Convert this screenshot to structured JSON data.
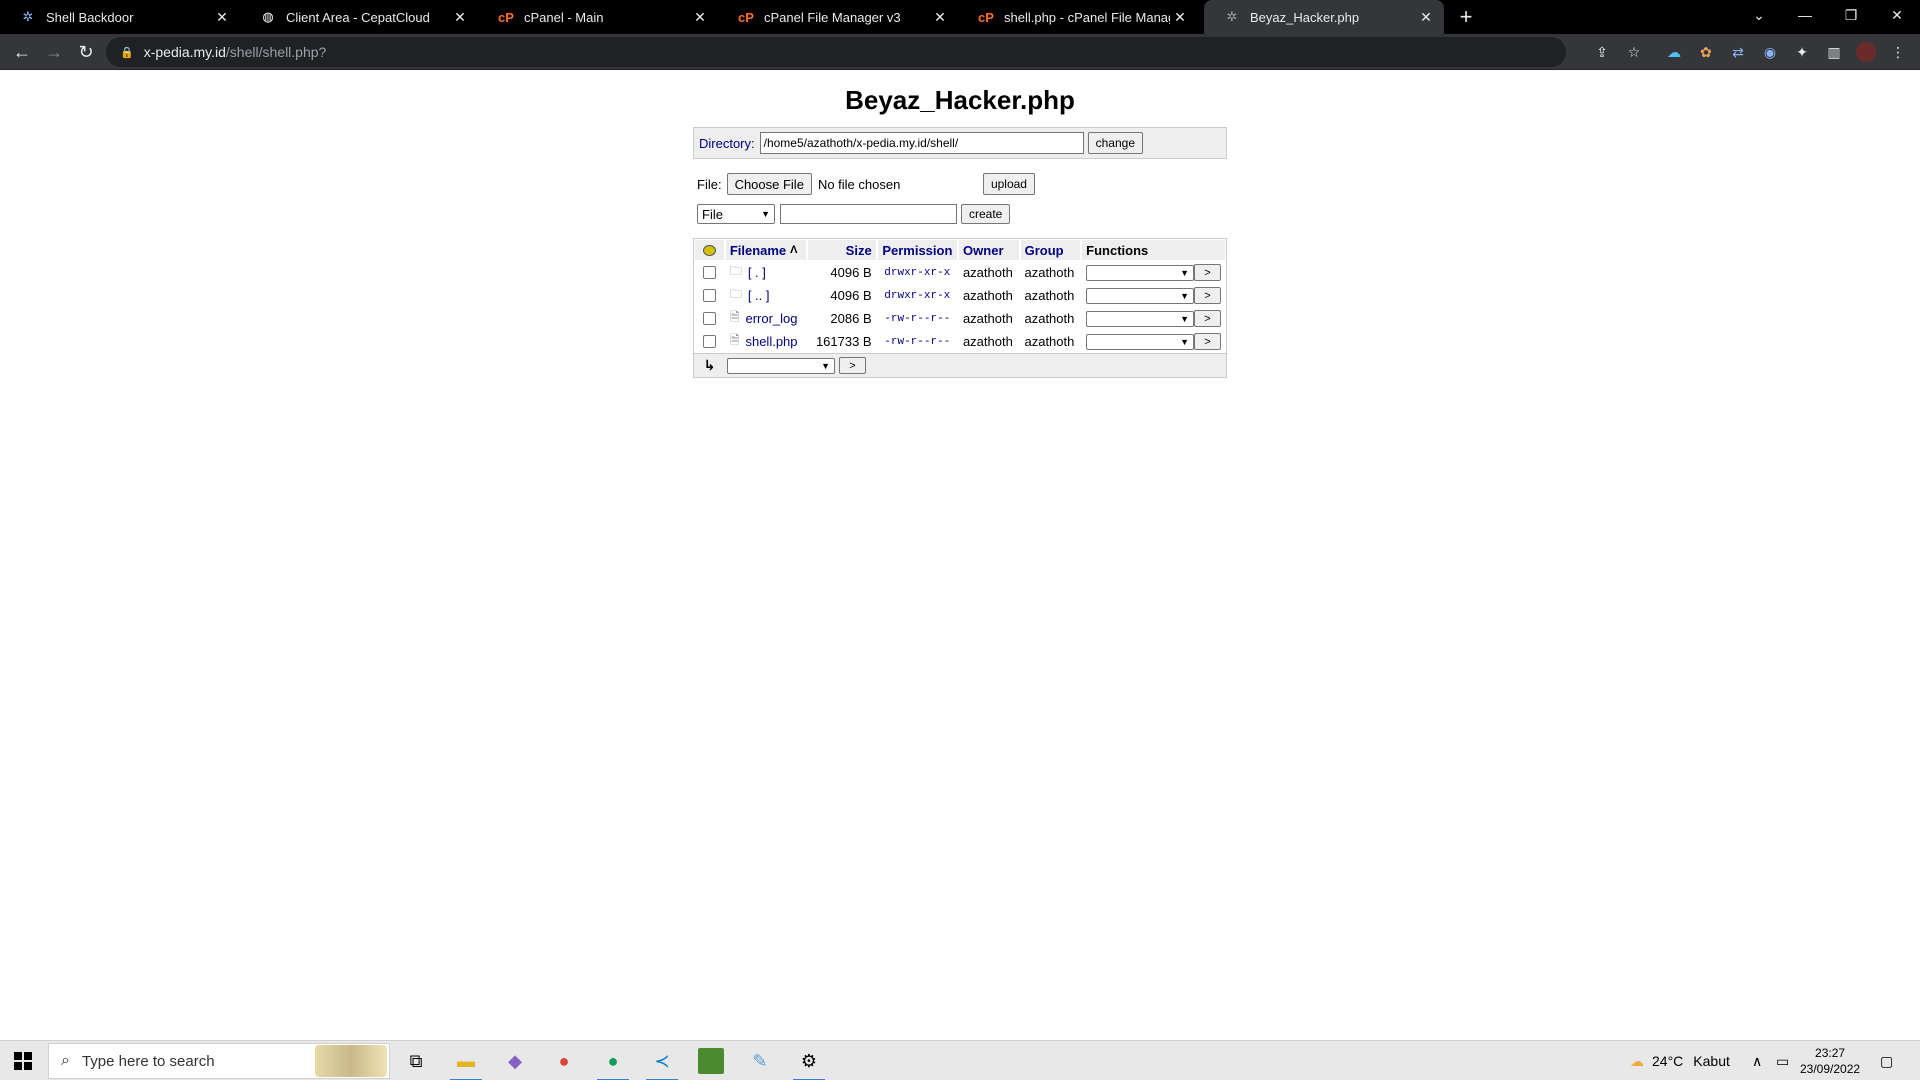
{
  "browser": {
    "tabs": [
      {
        "title": "Shell Backdoor",
        "icon": "gear-icon",
        "active": false
      },
      {
        "title": "Client Area - CepatCloud",
        "icon": "globe-icon",
        "active": false
      },
      {
        "title": "cPanel - Main",
        "icon": "cpanel-icon",
        "active": false
      },
      {
        "title": "cPanel File Manager v3",
        "icon": "cpanel-icon",
        "active": false
      },
      {
        "title": "shell.php - cPanel File Manager v",
        "icon": "cpanel-icon",
        "active": false
      },
      {
        "title": "Beyaz_Hacker.php",
        "icon": "gear-icon",
        "active": true
      }
    ],
    "url_host": "x-pedia.my.id",
    "url_path": "/shell/shell.php?"
  },
  "page": {
    "title": "Beyaz_Hacker.php",
    "directory_label": "Directory:",
    "directory_value": "/home5/azathoth/x-pedia.my.id/shell/",
    "change_label": "change",
    "file_label": "File:",
    "choose_file_label": "Choose File",
    "no_file_text": "No file chosen",
    "upload_label": "upload",
    "create_type": "File",
    "create_label": "create",
    "columns": {
      "filename": "Filename",
      "sort_indicator": "Λ",
      "size": "Size",
      "permission": "Permission",
      "owner": "Owner",
      "group": "Group",
      "functions": "Functions"
    },
    "rows": [
      {
        "name": "[ . ]",
        "type": "folder",
        "size": "4096 B",
        "perm": "drwxr-xr-x",
        "owner": "azathoth",
        "group": "azathoth",
        "go": ">"
      },
      {
        "name": "[ .. ]",
        "type": "folder",
        "size": "4096 B",
        "perm": "drwxr-xr-x",
        "owner": "azathoth",
        "group": "azathoth",
        "go": ">"
      },
      {
        "name": "error_log",
        "type": "file",
        "size": "2086 B",
        "perm": "-rw-r--r--",
        "owner": "azathoth",
        "group": "azathoth",
        "go": ">"
      },
      {
        "name": "shell.php",
        "type": "file",
        "size": "161733 B",
        "perm": "-rw-r--r--",
        "owner": "azathoth",
        "group": "azathoth",
        "go": ">"
      }
    ],
    "footer_go": ">"
  },
  "taskbar": {
    "search_placeholder": "Type here to search",
    "weather_temp": "24°C",
    "weather_text": "Kabut",
    "time": "23:27",
    "date": "23/09/2022"
  }
}
